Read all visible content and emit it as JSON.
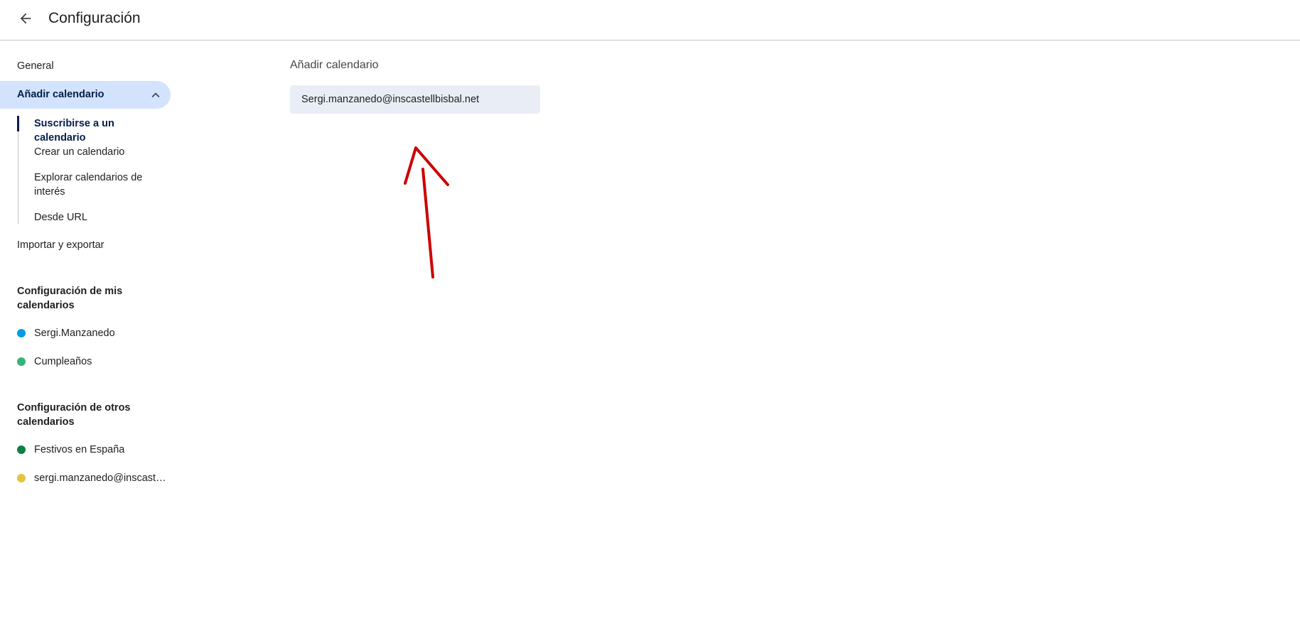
{
  "header": {
    "title": "Configuración",
    "back_icon": "arrow-back-icon"
  },
  "sidebar": {
    "general": "General",
    "add_calendar": "Añadir calendario",
    "sub_items": [
      "Suscribirse a un calendario",
      "Crear un calendario",
      "Explorar calendarios de interés",
      "Desde URL"
    ],
    "import_export": "Importar y exportar",
    "my_calendars_heading": "Configuración de mis calendarios",
    "my_calendars": [
      {
        "label": "Sergi.Manzanedo",
        "color": "#039be5"
      },
      {
        "label": "Cumpleaños",
        "color": "#33b679"
      }
    ],
    "other_calendars_heading": "Configuración de otros calendarios",
    "other_calendars": [
      {
        "label": "Festivos en España",
        "color": "#0b8043"
      },
      {
        "label": "sergi.manzanedo@inscastell...",
        "color": "#e4c441"
      }
    ]
  },
  "main": {
    "heading": "Añadir calendario",
    "email_value": "Sergi.manzanedo@inscastellbisbal.net"
  },
  "colors": {
    "accent": "#d3e3fd",
    "annotation": "#cc0000"
  }
}
